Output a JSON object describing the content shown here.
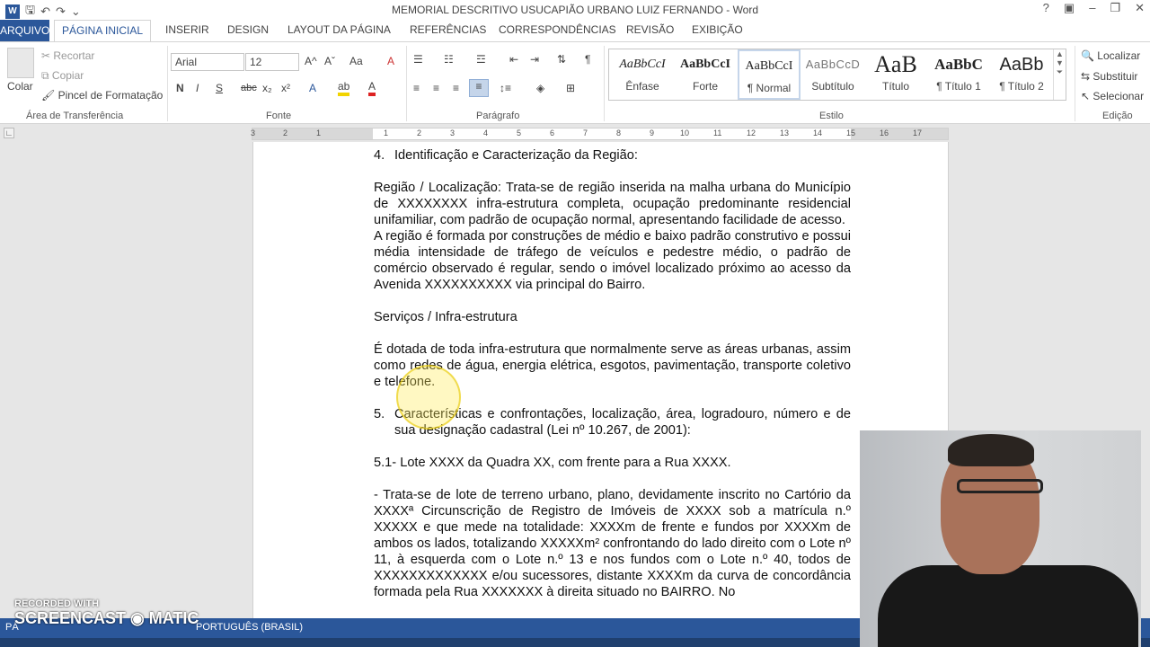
{
  "window": {
    "title": "MEMORIAL DESCRITIVO USUCAPIÃO URBANO LUIZ FERNANDO - Word"
  },
  "qat": {
    "app_icon": "W",
    "save": "🖫",
    "undo": "↶",
    "redo": "↷",
    "customize": "⌄"
  },
  "window_controls": {
    "help": "?",
    "options": "▣",
    "minimize": "–",
    "restore": "❐",
    "close": "✕"
  },
  "tabs": [
    {
      "label": "ARQUIVO"
    },
    {
      "label": "PÁGINA INICIAL"
    },
    {
      "label": "INSERIR"
    },
    {
      "label": "DESIGN"
    },
    {
      "label": "LAYOUT DA PÁGINA"
    },
    {
      "label": "REFERÊNCIAS"
    },
    {
      "label": "CORRESPONDÊNCIAS"
    },
    {
      "label": "REVISÃO"
    },
    {
      "label": "EXIBIÇÃO"
    }
  ],
  "clipboard": {
    "paste": "Colar",
    "cut": "Recortar",
    "copy": "Copiar",
    "format_painter": "Pincel de Formatação",
    "group": "Área de Transferência"
  },
  "font": {
    "name": "Arial",
    "size": "12",
    "group": "Fonte",
    "bold": "N",
    "italic": "I",
    "underline": "S",
    "strike": "abc",
    "sub": "x₂",
    "sup": "x²",
    "grow": "A^",
    "shrink": "Aˇ",
    "case": "Aa",
    "clear": "A"
  },
  "paragraph": {
    "group": "Parágrafo",
    "pilcrow": "¶"
  },
  "styles": {
    "group": "Estilo",
    "items": [
      {
        "preview": "AaBbCcI",
        "label": "Ênfase"
      },
      {
        "preview": "AaBbCcI",
        "label": "Forte"
      },
      {
        "preview": "AaBbCcI",
        "label": "¶ Normal"
      },
      {
        "preview": "AaBbCcD",
        "label": "Subtítulo"
      },
      {
        "preview": "AaB",
        "label": "Título"
      },
      {
        "preview": "AaBbC",
        "label": "¶ Título 1"
      },
      {
        "preview": "AaBb",
        "label": "¶ Título 2"
      }
    ]
  },
  "editing": {
    "group": "Edição",
    "find": "Localizar",
    "replace": "Substituir",
    "select": "Selecionar"
  },
  "ruler": {
    "ticks": [
      "3",
      "2",
      "1",
      "1",
      "2",
      "3",
      "4",
      "5",
      "6",
      "7",
      "8",
      "9",
      "10",
      "11",
      "12",
      "13",
      "14",
      "15",
      "16",
      "17"
    ]
  },
  "document": {
    "heading4": {
      "num": "4.",
      "text": "Identificação e Caracterização da Região:"
    },
    "p1": "Região / Localização: Trata-se de região inserida na malha urbana do Município de XXXXXXXX infra-estrutura completa, ocupação predominante residencial unifamiliar, com padrão de ocupação normal, apresentando facilidade de acesso.",
    "p2": "A região é formada por construções de médio e baixo padrão construtivo e possui média intensidade de tráfego de veículos e pedestre médio, o padrão de comércio observado é regular, sendo o imóvel localizado próximo ao acesso da Avenida XXXXXXXXXX via principal do Bairro.",
    "services": "Serviços / Infra-estrutura",
    "p3": "É dotada de toda infra-estrutura que normalmente serve as áreas urbanas, assim como redes de água, energia elétrica, esgotos, pavimentação, transporte coletivo e telefone.",
    "heading5": {
      "num": "5.",
      "text": "Características e confrontações, localização, área, logradouro, número e de sua designação cadastral (Lei nº 10.267, de 2001):"
    },
    "s51": "5.1- Lote XXXX da Quadra XX, com frente para a Rua XXXX.",
    "p4": "- Trata-se de lote de terreno urbano,  plano, devidamente inscrito no Cartório da XXXXª Circunscrição de  Registro de Imóveis de XXXX sob a matrícula n.º XXXXX e que mede na totalidade: XXXXm de frente e fundos por  XXXXm de ambos os lados, totalizando XXXXXm² confrontando do lado direito com o Lote nº 11, à esquerda com o Lote n.º 13 e nos fundos com o Lote n.º 40, todos de XXXXXXXXXXXXX e/ou sucessores, distante XXXXm da curva de concordância formada pela Rua XXXXXXX à direita situado no BAIRRO. No"
  },
  "status": {
    "page": "PÁ",
    "language": "PORTUGUÊS (BRASIL)"
  },
  "watermark": {
    "line1": "RECORDED WITH",
    "line2": "SCREENCAST",
    "line3": "MATIC"
  },
  "colors": {
    "accent": "#2b579a",
    "highlight": "#f2d400",
    "font_color": "#d22"
  }
}
